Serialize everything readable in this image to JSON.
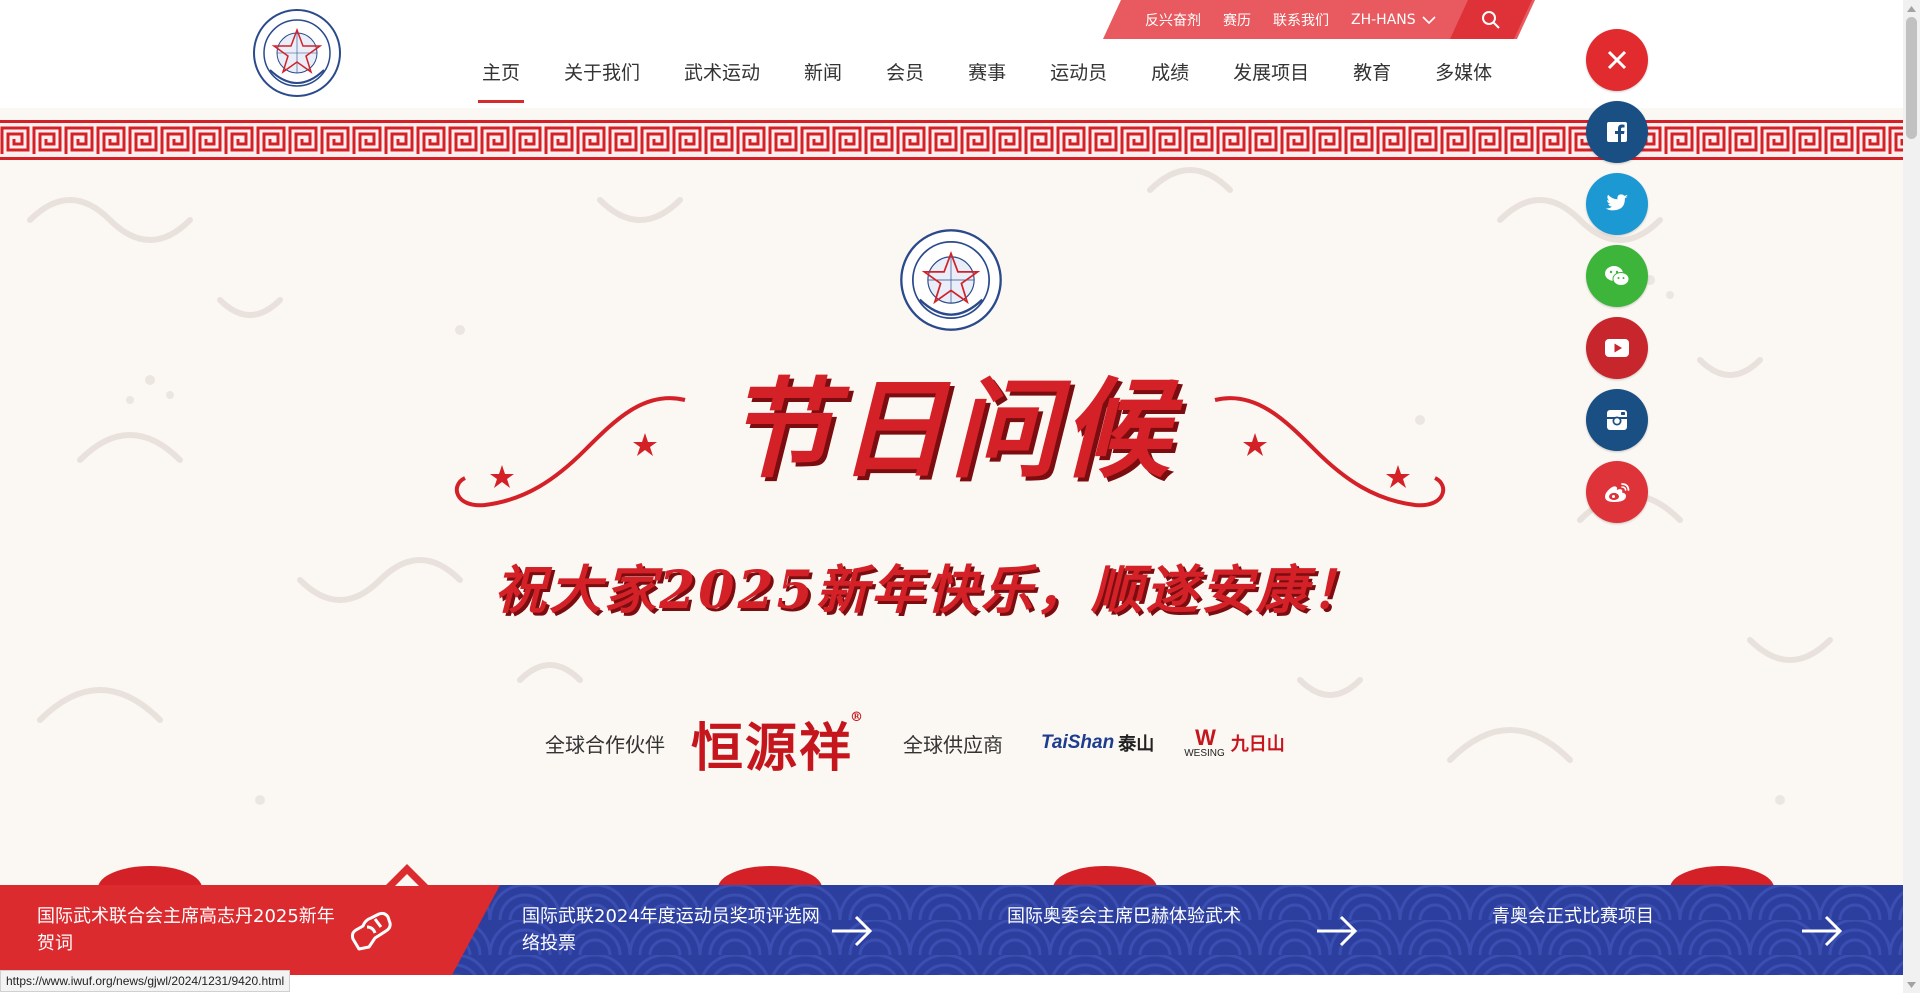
{
  "topbar": {
    "links": [
      "反兴奋剂",
      "赛历",
      "联系我们"
    ],
    "language": "ZH-HANS"
  },
  "nav": {
    "items": [
      "主页",
      "关于我们",
      "武术运动",
      "新闻",
      "会员",
      "赛事",
      "运动员",
      "成绩",
      "发展项目",
      "教育",
      "多媒体"
    ],
    "active_index": 0
  },
  "banner": {
    "headline": "节日问候",
    "subline": "祝大家2025新年快乐，顺遂安康！",
    "partner_label": "全球合作伙伴",
    "partner_brand": "恒源祥",
    "partner_reg": "®",
    "supplier_label": "全球供应商",
    "supplier_taishan": "TaiShan",
    "supplier_taishan_cn": "泰山",
    "supplier_wesing_mark": "W",
    "supplier_wesing": "WESING",
    "supplier_wesing_cn": "九日山"
  },
  "social": [
    "close-icon",
    "facebook-icon",
    "twitter-icon",
    "wechat-icon",
    "youtube-icon",
    "instagram-icon",
    "weibo-icon"
  ],
  "news": [
    {
      "title": "国际武术联合会主席高志丹2025新年贺词"
    },
    {
      "title": "国际武联2024年度运动员奖项评选网络投票"
    },
    {
      "title": "国际奥委会主席巴赫体验武术"
    },
    {
      "title": "青奥会正式比赛项目"
    }
  ],
  "statusbar": {
    "url": "https://www.iwuf.org/news/gjwl/2024/1231/9420.html"
  },
  "colors": {
    "brand_red": "#d42128",
    "navy": "#1a4f84",
    "strip_blue": "#2d3f9e"
  }
}
